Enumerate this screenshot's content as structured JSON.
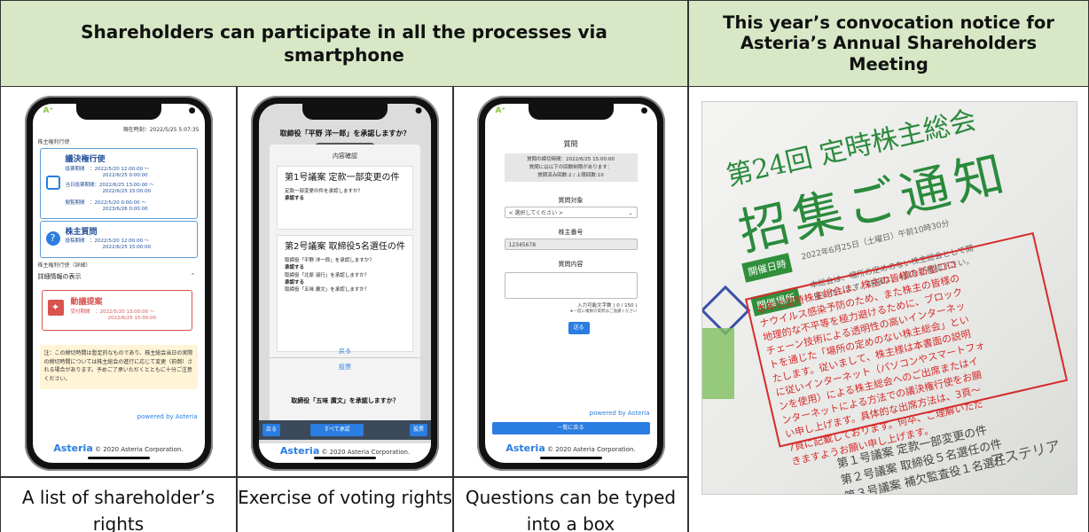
{
  "table": {
    "header_left": "Shareholders can participate in all the processes via smartphone",
    "header_right": "This year’s convocation notice for Asteria’s Annual Shareholders Meeting",
    "captions": [
      "A list of shareholder’s rights",
      "Exercise of voting rights",
      "Questions can be typed into a box"
    ]
  },
  "phone1": {
    "timestamp": "現在時刻：2022/5/25 5:07:35",
    "section_title": "株主権利行使",
    "card1": {
      "title": "議決権行使",
      "lines": [
        "投票期間　：2022/5/20 12:00:00 〜",
        "2022/6/25 0:00:00",
        "当日投票期間：2022/6/25 13:00:00 〜",
        "2022/6/25 15:00:00",
        "閲覧期間　：2022/5/20 0:00:00 〜",
        "2023/6/26 0:00:00"
      ]
    },
    "card2": {
      "title": "株主質問",
      "lines": [
        "投稿期間　：2022/5/20 12:00:00 〜",
        "2022/6/25 15:00:00"
      ]
    },
    "detail_section": "株主権利行使（詳細）",
    "detail_toggle": "詳細情報の表示",
    "card3": {
      "title": "動議提案",
      "lines": [
        "受付期間　：2022/5/20 13:00:00 〜",
        "2022/6/25 15:00:00"
      ]
    },
    "note": "注：この締切時間は暫定的なものであり、株主総会当日の実際の締切時間については株主総会の進行に応じて変更（前倒）される場合があります。予めご了承いただくとともに十分ご注意ください。",
    "powered": "powered by Asteria",
    "footer_brand": "Asteria",
    "footer_copy": "© 2020 Asteria Corporation."
  },
  "phone2": {
    "question_top": "取締役「平野 洋一郎」を承認しますか？",
    "modal_title": "内容確認",
    "item1_title": "第1号議案 定款一部変更の件",
    "item1_q": "定款一部変更の件を承認しますか？",
    "item1_a": "承認する",
    "item2_title": "第2号議案 取締役5名選任の件",
    "item2_lines": [
      "取締役「平野 洋一郎」を承認しますか？",
      "承認する",
      "取締役「北原 淑行」を承認しますか？",
      "承認する",
      "取締役「五味 廣文」を承認しますか？"
    ],
    "back": "戻る",
    "vote": "投票",
    "question_bottom": "取締役「五味 廣文」を承認しますか？",
    "btn_back": "戻る",
    "btn_approve_all": "すべて承認",
    "btn_vote": "投票",
    "footer_brand": "Asteria",
    "footer_copy": "© 2020 Asteria Corporation."
  },
  "phone3": {
    "title": "質問",
    "info": [
      "質問の締切時間：2022/6/25 15:00:00",
      "質問には以下の回数制限があります：",
      "質問済み回数:2 / 上限回数:10"
    ],
    "target_label": "質問対象",
    "target_placeholder": "< 選択してください >",
    "number_label": "株主番号",
    "number_value": "12345678",
    "content_label": "質問内容",
    "char_count": "入力可能文字数 ( 0 / 150 )",
    "char_note": "★一度に複数の質問はご遠慮ください",
    "send": "送る",
    "powered": "powered by Asteria",
    "back_to_list": "一覧に戻る",
    "footer_brand": "Asteria",
    "footer_copy": "© 2020 Asteria Corporation."
  },
  "photo": {
    "title_small": "第24回 定時株主総会",
    "title_large": "招集ご通知",
    "tag_date": "開催日時",
    "tag_place": "開催場所",
    "date_text": "2022年6月25日（土曜日）午前10時30分",
    "place_text": "本総会は、場所の定めのない株主総会として開",
    "place_text2": "催いたします。詳細は、4頁をご確認下さい。",
    "red_box": "本年の定時株主総会は、株主の皆様の新型コロ\nナウイルス感染予防のため、また株主の皆様の\n地理的な不平等を極力避けるために、ブロック\nチェーン技術による透明性の高いインターネッ\nトを通じた「場所の定めのない株主総会」とい\nたします。従いまして、株主様は本書面の説明\nに従いインターネット（パソコンやスマートフォ\nンを使用）による株主総会へのご出席またはイ\nンターネットによる方法での議決権行使をお願\nい申し上げます。具体的な出席方法は、3頁〜\n7頁に記載しております。何卒、ご理解いただ\nきますようお願い申し上げます。",
    "agenda": "第１号議案 定款一部変更の件\n第２号議案 取締役５名選任の件\n第３号議案 補欠監査役１名選任",
    "kanji_tag": "議　案",
    "company": "アステリア"
  }
}
